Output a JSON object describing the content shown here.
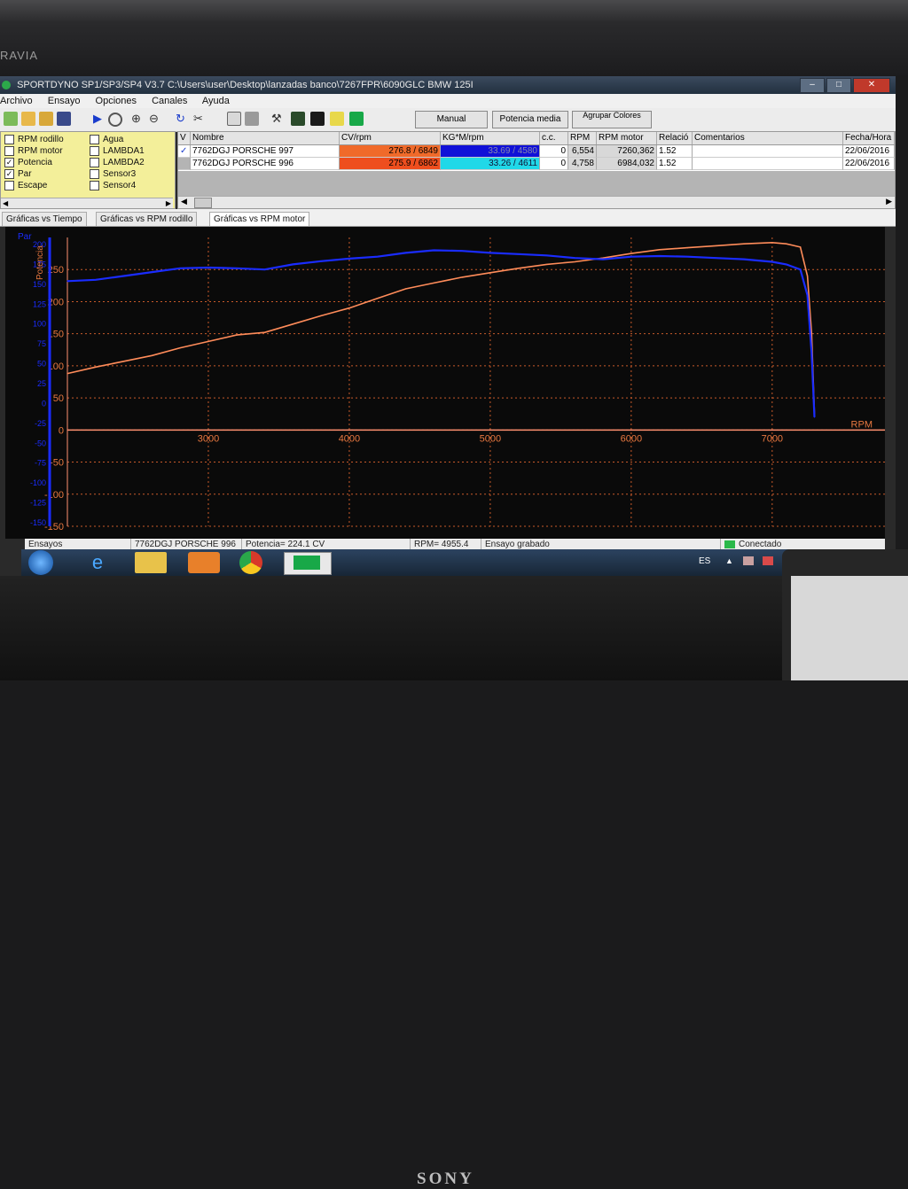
{
  "monitor": {
    "brand_top": "RAVIA",
    "brand_bottom": "SONY"
  },
  "window": {
    "title": "SPORTDYNO SP1/SP3/SP4 V3.7  C:\\Users\\user\\Desktop\\lanzadas banco\\7267FPR\\6090GLC BMW 125I"
  },
  "menu": [
    "Archivo",
    "Ensayo",
    "Opciones",
    "Canales",
    "Ayuda"
  ],
  "toolbar": {
    "manual": "Manual",
    "potencia_media": "Potencia media",
    "agrupar": "Agrupar Colores"
  },
  "channels": [
    {
      "label": "RPM rodillo",
      "checked": false
    },
    {
      "label": "Agua",
      "checked": false
    },
    {
      "label": "RPM motor",
      "checked": false
    },
    {
      "label": "LAMBDA1",
      "checked": false
    },
    {
      "label": "Potencia",
      "checked": true
    },
    {
      "label": "LAMBDA2",
      "checked": false
    },
    {
      "label": "Par",
      "checked": true
    },
    {
      "label": "Sensor3",
      "checked": false
    },
    {
      "label": "Escape",
      "checked": false
    },
    {
      "label": "Sensor4",
      "checked": false
    }
  ],
  "grid": {
    "headers": [
      "V",
      "Nombre",
      "CV/rpm",
      "KG*M/rpm",
      "c.c.",
      "RPM",
      "RPM motor",
      "Relació",
      "Comentarios",
      "Fecha/Hora"
    ],
    "rows": [
      {
        "v": "✓",
        "nombre": "7762DGJ PORSCHE 997",
        "cv": "276.8 / 6849",
        "kgm": "33.69 / 4580",
        "cc": "0",
        "rpm": "6,554",
        "rpm_motor": "7260,362",
        "rel": "1.52",
        "com": "",
        "fecha": "22/06/2016",
        "cv_color": "#f06a2a",
        "kgm_color": "#1010d8"
      },
      {
        "v": "",
        "nombre": "7762DGJ PORSCHE 996",
        "cv": "275.9 / 6862",
        "kgm": "33.26 / 4611",
        "cc": "0",
        "rpm": "4,758",
        "rpm_motor": "6984,032",
        "rel": "1.52",
        "com": "",
        "fecha": "22/06/2016",
        "cv_color": "#ee4e1e",
        "kgm_color": "#20d8e8"
      }
    ]
  },
  "tabs": [
    "Gráficas vs Tiempo",
    "Gráficas vs RPM rodillo",
    "Gráficas vs RPM motor"
  ],
  "active_tab": 2,
  "chart_data": {
    "type": "line",
    "xlabel": "RPM",
    "ylabel": "Potencia",
    "ylabel_left": "Par",
    "x_ticks": [
      3000,
      4000,
      5000,
      6000,
      7000
    ],
    "y_ticks": [
      250,
      200,
      150,
      100,
      50,
      0
    ],
    "y_left_ticks": [
      200,
      175,
      150,
      125,
      100,
      75,
      50,
      25,
      0,
      -25,
      -50,
      -75,
      -100,
      -125,
      -150
    ],
    "xlim": [
      2000,
      7800
    ],
    "ylim": [
      -150,
      300
    ],
    "grid": true,
    "series": [
      {
        "color": "#ff8c5a",
        "x": [
          2000,
          2200,
          2400,
          2600,
          2800,
          3000,
          3200,
          3400,
          3600,
          3800,
          4000,
          4200,
          4400,
          4600,
          4800,
          5000,
          5200,
          5400,
          5600,
          5800,
          6000,
          6200,
          6400,
          6600,
          6800,
          7000,
          7100,
          7200,
          7250,
          7280,
          7300
        ],
        "y": [
          88,
          98,
          107,
          116,
          128,
          138,
          148,
          152,
          165,
          178,
          190,
          205,
          220,
          229,
          238,
          245,
          252,
          258,
          262,
          268,
          275,
          281,
          284,
          287,
          290,
          292,
          290,
          285,
          240,
          150,
          25
        ]
      },
      {
        "color": "#1a2cff",
        "x": [
          2000,
          2200,
          2400,
          2600,
          2800,
          3000,
          3200,
          3400,
          3600,
          3800,
          4000,
          4200,
          4400,
          4600,
          4800,
          5000,
          5200,
          5400,
          5600,
          5800,
          6000,
          6200,
          6400,
          6600,
          6800,
          7000,
          7100,
          7200,
          7250,
          7280,
          7300
        ],
        "y": [
          232,
          234,
          240,
          246,
          252,
          253,
          252,
          250,
          258,
          263,
          267,
          270,
          276,
          280,
          279,
          276,
          274,
          272,
          268,
          266,
          270,
          271,
          270,
          268,
          266,
          262,
          258,
          250,
          210,
          120,
          20
        ]
      }
    ]
  },
  "status": {
    "ensayos": "Ensayos",
    "nombre": "7762DGJ PORSCHE 996",
    "potencia": "Potencia= 224.1 CV",
    "rpm": "RPM= 4955.4",
    "grabado": "Ensayo grabado",
    "conectado": "Conectado"
  },
  "taskbar": {
    "lang": "ES"
  }
}
